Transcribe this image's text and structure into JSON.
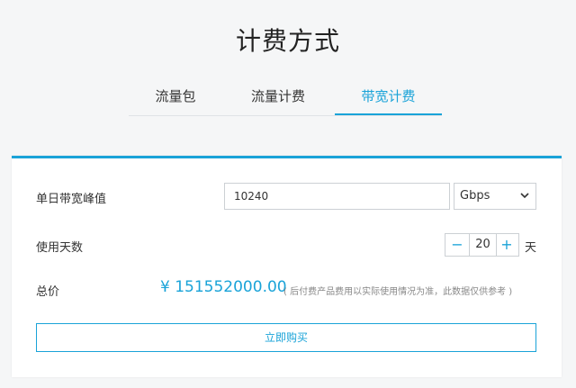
{
  "page": {
    "title": "计费方式"
  },
  "tabs": [
    {
      "label": "流量包"
    },
    {
      "label": "流量计费"
    },
    {
      "label": "带宽计费",
      "active": true
    }
  ],
  "accent_color": "#1aa3d8",
  "form": {
    "peak_bandwidth_label": "单日带宽峰值",
    "peak_bandwidth_value": "10240",
    "unit_select": {
      "value": "Gbps",
      "icon": "chevron-down-icon"
    },
    "days_label": "使用天数",
    "days_value": "20",
    "days_minus": "−",
    "days_plus": "+",
    "days_unit": "天",
    "total_label": "总价",
    "total_price": "¥ 151552000.00",
    "total_note": "( 后付费产品费用以实际使用情况为准，此数据仅供参考 )",
    "buy_label": "立即购买"
  }
}
